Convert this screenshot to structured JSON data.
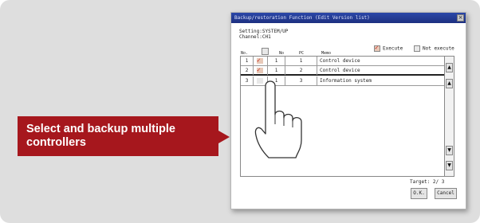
{
  "window": {
    "title": "Backup/restoration Function (Edit Version list)",
    "close_label": "×",
    "header_line1": "Setting:SYSTEM/UP",
    "header_line2": "Channel:CH1",
    "legend": {
      "execute": "Execute",
      "not_execute": "Not execute"
    },
    "columns": [
      "No.",
      "",
      "No",
      "PC",
      "Memo"
    ],
    "rows": [
      {
        "no": "1",
        "checked": true,
        "unit": "1",
        "pc": "1",
        "memo": "Control device"
      },
      {
        "no": "2",
        "checked": true,
        "unit": "1",
        "pc": "2",
        "memo": "Control device"
      },
      {
        "no": "3",
        "checked": false,
        "unit": "1",
        "pc": "3",
        "memo": "Information system"
      }
    ],
    "target_label": "Target:",
    "target_value": "2/",
    "target_total": "3",
    "ok_label": "O.K.",
    "cancel_label": "Cancel"
  },
  "callout": {
    "text": "Select and backup multiple controllers",
    "color": "#a6171d"
  },
  "icons": [
    "pointing-hand-icon",
    "scroll-up-icon",
    "scroll-down-icon",
    "close-icon"
  ]
}
